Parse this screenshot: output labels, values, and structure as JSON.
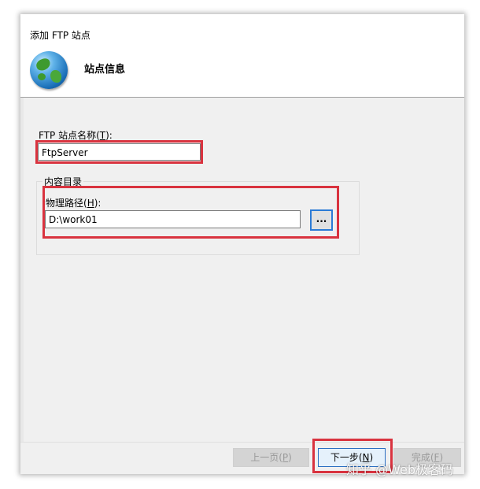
{
  "dialog": {
    "title": "添加 FTP 站点",
    "heading": "站点信息"
  },
  "site_name": {
    "label_prefix": "FTP 站点名称(",
    "label_key": "T",
    "label_suffix": "):",
    "value": "FtpServer"
  },
  "content_directory": {
    "group_title": "内容目录",
    "path_label_prefix": "物理路径(",
    "path_label_key": "H",
    "path_label_suffix": "):",
    "path_value": "D:\\work01",
    "browse_label": "..."
  },
  "buttons": {
    "prev": {
      "label_prefix": "上一页(",
      "key": "P",
      "label_suffix": ")"
    },
    "next": {
      "label_prefix": "下一步(",
      "key": "N",
      "label_suffix": ")"
    },
    "finish": {
      "label_prefix": "完成(",
      "key": "F",
      "label_suffix": ")"
    }
  },
  "watermark": "知乎 @Web极客码",
  "colors": {
    "highlight_box": "#d9333f",
    "focus_border": "#2b7bd6",
    "dialog_bg": "#f0f0f0"
  }
}
